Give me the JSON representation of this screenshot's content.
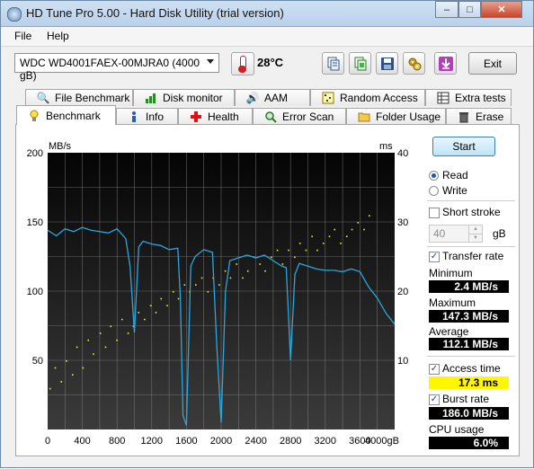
{
  "window": {
    "title": "HD Tune Pro 5.00 - Hard Disk Utility (trial version)",
    "min_symbol": "–",
    "max_symbol": "□",
    "close_symbol": "✕"
  },
  "menu": {
    "file": "File",
    "help": "Help"
  },
  "toolbar": {
    "drive": "WDC WD4001FAEX-00MJRA0 (4000 gB)",
    "temperature": "28°C",
    "exit_label": "Exit",
    "buttons": [
      "copy-info-icon",
      "copy-screenshot-icon",
      "save-icon",
      "options-icon",
      "download-icon"
    ]
  },
  "tabs_top": [
    "File Benchmark",
    "Disk monitor",
    "AAM",
    "Random Access",
    "Extra tests"
  ],
  "tabs_bottom": [
    "Benchmark",
    "Info",
    "Health",
    "Error Scan",
    "Folder Usage",
    "Erase"
  ],
  "graph": {
    "left_unit": "MB/s",
    "right_unit": "ms",
    "left_ticks": [
      "200",
      "150",
      "100",
      "50"
    ],
    "right_ticks": [
      "40",
      "30",
      "20",
      "10"
    ],
    "x_ticks": [
      "0",
      "400",
      "800",
      "1200",
      "1600",
      "2000",
      "2400",
      "2800",
      "3200",
      "3600",
      "4000gB"
    ],
    "colors": {
      "transfer": "#2aa7de",
      "access": "#f0f020",
      "grid": "#8a8a8a"
    }
  },
  "controls": {
    "start_label": "Start",
    "read_label": "Read",
    "write_label": "Write",
    "short_stroke_label": "Short stroke",
    "short_stroke_value": "40",
    "short_stroke_unit": "gB",
    "transfer_rate_label": "Transfer rate",
    "minimum_label": "Minimum",
    "minimum_value": "2.4 MB/s",
    "maximum_label": "Maximum",
    "maximum_value": "147.3 MB/s",
    "average_label": "Average",
    "average_value": "112.1 MB/s",
    "access_time_label": "Access time",
    "access_time_value": "17.3 ms",
    "burst_rate_label": "Burst rate",
    "burst_rate_value": "186.0 MB/s",
    "cpu_usage_label": "CPU usage",
    "cpu_usage_value": "6.0%"
  },
  "chart_data": {
    "type": "line",
    "x_unit": "gB",
    "xlim": [
      0,
      4000
    ],
    "ylim_left": [
      0,
      200
    ],
    "ylim_right": [
      0,
      40
    ],
    "series": [
      {
        "name": "Transfer rate",
        "axis": "left",
        "x": [
          0,
          100,
          200,
          300,
          400,
          500,
          600,
          700,
          800,
          900,
          950,
          1000,
          1050,
          1100,
          1200,
          1300,
          1400,
          1500,
          1530,
          1560,
          1600,
          1650,
          1700,
          1800,
          1900,
          1950,
          2000,
          2050,
          2100,
          2200,
          2300,
          2400,
          2500,
          2600,
          2700,
          2750,
          2800,
          2850,
          2900,
          3000,
          3100,
          3200,
          3300,
          3400,
          3500,
          3600,
          3700,
          3800,
          3900,
          4000
        ],
        "values": [
          144,
          140,
          145,
          143,
          146,
          144,
          143,
          142,
          145,
          138,
          118,
          70,
          132,
          136,
          134,
          133,
          130,
          131,
          95,
          10,
          3,
          118,
          125,
          130,
          128,
          60,
          5,
          100,
          122,
          124,
          126,
          124,
          126,
          122,
          118,
          117,
          50,
          112,
          120,
          118,
          116,
          115,
          115,
          114,
          116,
          114,
          103,
          95,
          84,
          76
        ]
      }
    ],
    "scatter": {
      "name": "Access time",
      "axis": "right",
      "x": [
        20,
        80,
        150,
        210,
        280,
        330,
        400,
        460,
        520,
        600,
        660,
        720,
        790,
        850,
        920,
        980,
        1040,
        1110,
        1180,
        1240,
        1300,
        1370,
        1440,
        1500,
        1570,
        1630,
        1700,
        1770,
        1840,
        1900,
        1970,
        2040,
        2100,
        2170,
        2240,
        2300,
        2370,
        2440,
        2500,
        2570,
        2640,
        2700,
        2770,
        2840,
        2900,
        2970,
        3040,
        3100,
        3170,
        3240,
        3300,
        3370,
        3440,
        3500,
        3570,
        3640,
        3700
      ],
      "values": [
        6,
        9,
        7,
        10,
        8,
        12,
        9,
        13,
        11,
        14,
        12,
        15,
        13,
        16,
        14,
        15,
        17,
        16,
        18,
        17,
        19,
        18,
        20,
        19,
        21,
        20,
        21,
        22,
        20,
        22,
        21,
        23,
        22,
        24,
        22,
        23,
        25,
        24,
        23,
        25,
        26,
        24,
        26,
        25,
        27,
        26,
        28,
        26,
        27,
        28,
        29,
        27,
        28,
        29,
        30,
        29,
        31
      ]
    }
  }
}
